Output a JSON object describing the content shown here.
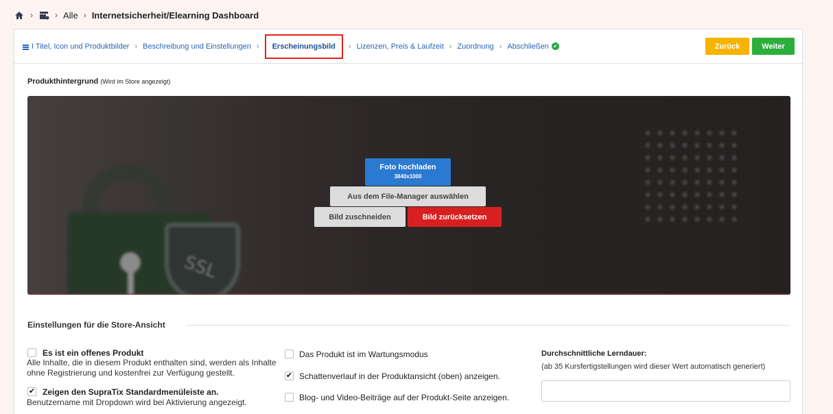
{
  "breadcrumb": {
    "all": "Alle",
    "current": "Internetsicherheit/Elearning Dashboard"
  },
  "steps": [
    {
      "label": "I Titel, Icon und Produktbilder"
    },
    {
      "label": "Beschreibung und Einstellungen"
    },
    {
      "label": "Erscheinungsbild",
      "active": true
    },
    {
      "label": "Lizenzen, Preis & Laufzeit"
    },
    {
      "label": "Zuordnung"
    },
    {
      "label": "Abschließen"
    }
  ],
  "actions": {
    "back": "Zurück",
    "next": "Weiter"
  },
  "background_section": {
    "title": "Produkthintergrund",
    "hint": "(Wird im Store angezeigt)",
    "image_text": "SSL",
    "upload_label": "Foto hochladen",
    "upload_size": "3840x1000",
    "file_manager": "Aus dem File-Manager auswählen",
    "crop": "Bild zuschneiden",
    "reset": "Bild zurücksetzen"
  },
  "store_settings": {
    "title": "Einstellungen für die Store-Ansicht",
    "open_product": {
      "label": "Es ist ein offenes Produkt",
      "checked": false,
      "desc_line1": "Alle Inhalte, die in diesem Produkt enthalten sind, werden als Inhalte",
      "desc_line2": "ohne Registrierung und kostenfrei zur Verfügung gestellt."
    },
    "show_menu": {
      "label": "Zeigen den SupraTix Standardmenüleiste an.",
      "checked": true,
      "desc": "Benutzername mit Dropdown wird bei Aktivierung angezeigt."
    },
    "maintenance": {
      "label": "Das Produkt ist im Wartungsmodus",
      "checked": false
    },
    "shadow": {
      "label": "Schattenverlauf in der Produktansicht (oben) anzeigen.",
      "checked": true
    },
    "blog": {
      "label": "Blog- und Video-Beiträge auf der Produkt-Seite anzeigen.",
      "checked": false
    },
    "learning": {
      "title": "Durchschnittliche Lerndauer:",
      "subtitle": "(ab 35 Kursfertigstellungen wird dieser Wert automatisch generiert)",
      "value": ""
    }
  },
  "check_mark": "✔",
  "chevron": "›"
}
